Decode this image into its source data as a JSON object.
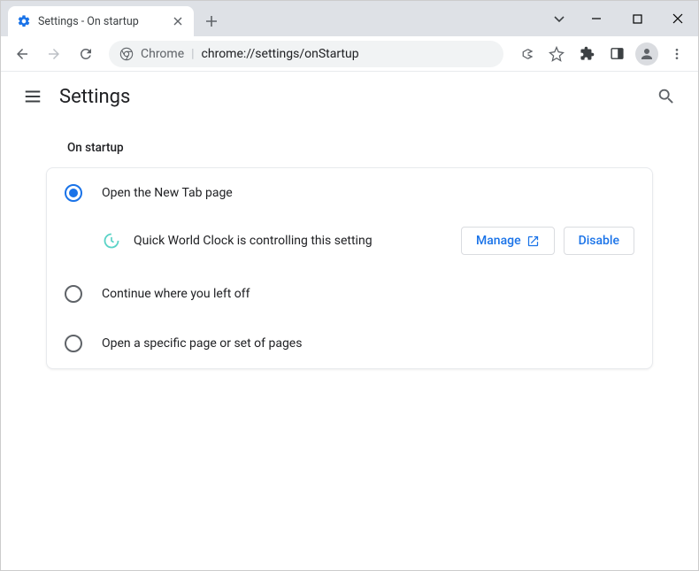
{
  "window": {
    "tab_title": "Settings - On startup"
  },
  "toolbar": {
    "origin_label": "Chrome",
    "url_path": "chrome://settings/onStartup"
  },
  "header": {
    "title": "Settings"
  },
  "section": {
    "title": "On startup",
    "options": [
      {
        "label": "Open the New Tab page",
        "checked": true
      },
      {
        "label": "Continue where you left off",
        "checked": false
      },
      {
        "label": "Open a specific page or set of pages",
        "checked": false
      }
    ],
    "extension_notice": {
      "name": "Quick World Clock",
      "text": "Quick World Clock is controlling this setting",
      "manage_label": "Manage",
      "disable_label": "Disable"
    }
  }
}
